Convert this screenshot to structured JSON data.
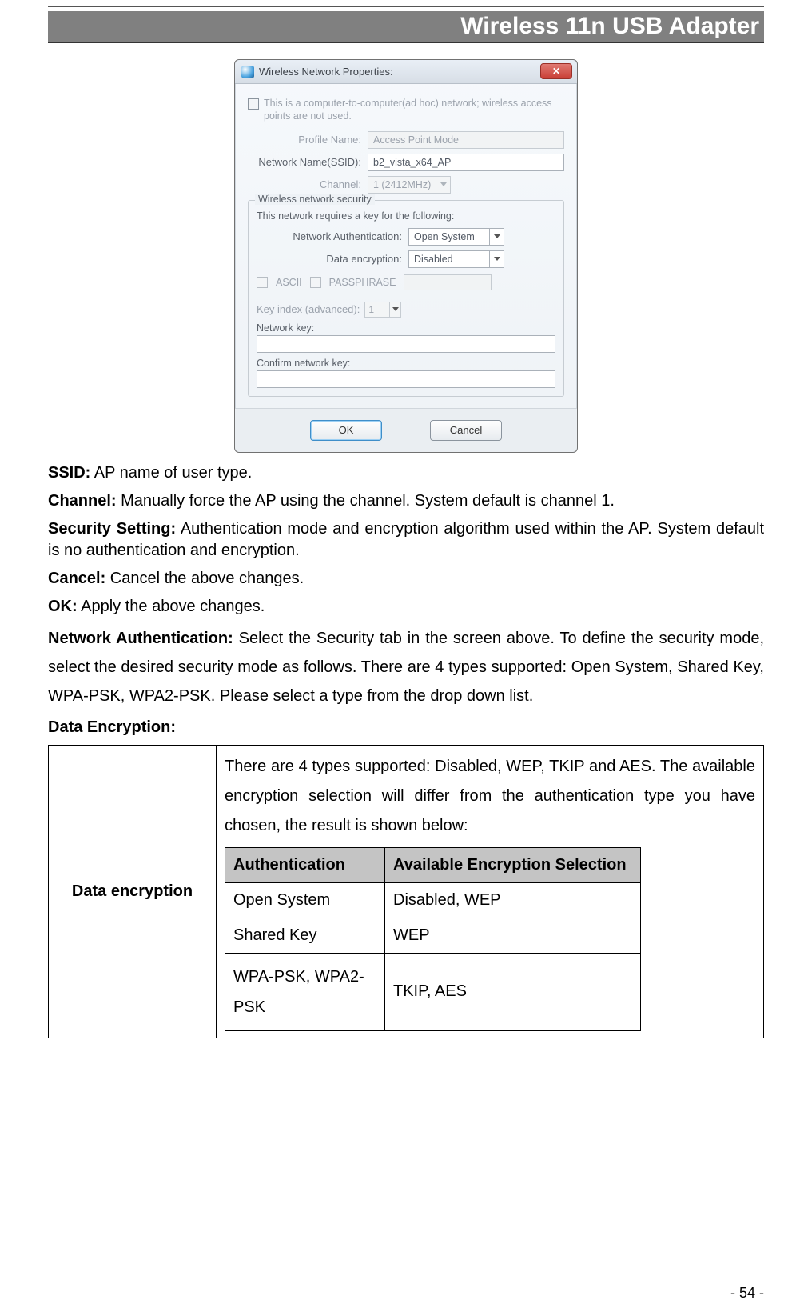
{
  "header": {
    "title": "Wireless 11n USB Adapter"
  },
  "dialog": {
    "title": "Wireless Network Properties:",
    "close_glyph": "✕",
    "adhoc_text": "This is a computer-to-computer(ad hoc) network; wireless access points are not used.",
    "profile_label": "Profile Name:",
    "profile_value": "Access Point Mode",
    "ssid_label": "Network Name(SSID):",
    "ssid_value": "b2_vista_x64_AP",
    "channel_label": "Channel:",
    "channel_value": "1 (2412MHz)",
    "group_label": "Wireless network security",
    "group_sub": "This network requires a key for the following:",
    "auth_label": "Network Authentication:",
    "auth_value": "Open System",
    "enc_label": "Data encryption:",
    "enc_value": "Disabled",
    "ascii_label": "ASCII",
    "pass_label": "PASSPHRASE",
    "keyidx_label": "Key index (advanced):",
    "keyidx_value": "1",
    "netkey_label": "Network key:",
    "confirm_label": "Confirm network key:",
    "ok_label": "OK",
    "cancel_label": "Cancel"
  },
  "body": {
    "ssid_b": "SSID:",
    "ssid_t": " AP name of user type.",
    "channel_b": "Channel:",
    "channel_t": " Manually force the AP using the channel. System default is channel 1.",
    "sec_b": "Security Setting:",
    "sec_t": " Authentication mode and encryption algorithm used within the AP. System default is no authentication and encryption.",
    "cancel_b": "Cancel:",
    "cancel_t": " Cancel the above changes.",
    "ok_b": "OK:",
    "ok_t": " Apply the above changes.",
    "na_b": "Network Authentication:",
    "na_t": " Select the Security tab in the screen above. To define the security mode, select the desired security mode as follows. There are 4 types supported: Open System, Shared Key, WPA-PSK, WPA2-PSK. Please select a type from the drop down list.",
    "de_b": "Data Encryption:"
  },
  "table": {
    "side": "Data encryption",
    "desc": "There are 4 types supported: Disabled, WEP, TKIP and AES. The available encryption selection will differ from the authentication type you have chosen, the result is shown below:",
    "h1": "Authentication",
    "h2": "Available Encryption Selection",
    "r1a": "Open System",
    "r1b": "Disabled, WEP",
    "r2a": "Shared Key",
    "r2b": "WEP",
    "r3a": " WPA-PSK, WPA2-PSK",
    "r3b": "TKIP, AES"
  },
  "page_number": "- 54 -"
}
